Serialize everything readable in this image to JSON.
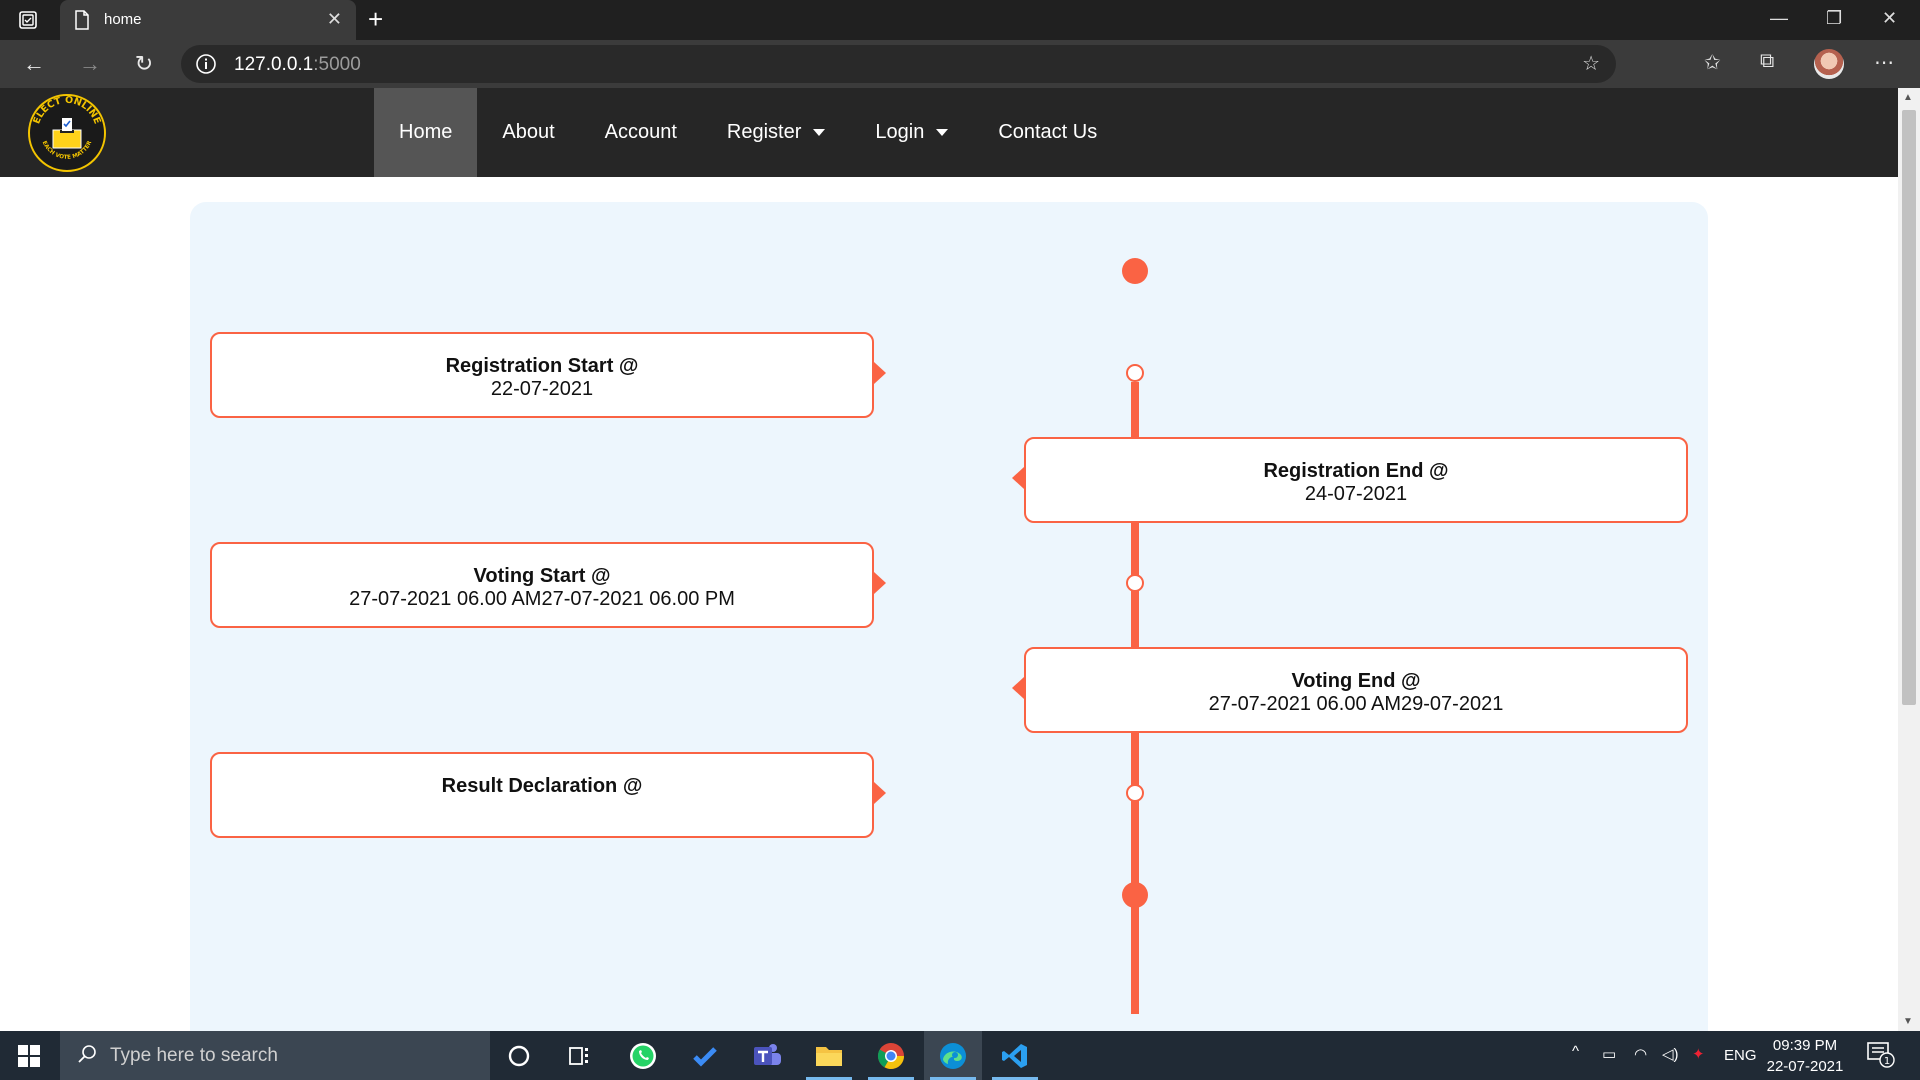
{
  "browser": {
    "tab_title": "home",
    "url_host": "127.0.0.1",
    "url_port": ":5000"
  },
  "site": {
    "logo_text_top": "ELECT ONLINE",
    "logo_text_bottom": "EACH VOTE MATTER",
    "nav": {
      "home": "Home",
      "about": "About",
      "account": "Account",
      "register": "Register",
      "login": "Login",
      "contact": "Contact Us"
    },
    "active_nav": "Home"
  },
  "timeline": [
    {
      "title": "Registration Start @",
      "date": "22-07-2021"
    },
    {
      "title": "Registration End @",
      "date": "24-07-2021"
    },
    {
      "title": "Voting Start @",
      "date": "27-07-2021 06.00 AM27-07-2021 06.00 PM"
    },
    {
      "title": "Voting End @",
      "date": "27-07-2021 06.00 AM29-07-2021"
    },
    {
      "title": "Result Declaration @",
      "date": ""
    }
  ],
  "colors": {
    "accent": "#fa6344",
    "navbar": "#262626",
    "nav_active": "#555555",
    "panel": "#edf6fd"
  },
  "taskbar": {
    "search_placeholder": "Type here to search",
    "apps": [
      "cortana-icon",
      "task-view-icon",
      "whatsapp-icon",
      "todo-icon",
      "teams-icon",
      "file-explorer-icon",
      "chrome-icon",
      "edge-icon",
      "vscode-icon"
    ],
    "language": "ENG",
    "time": "09:39 PM",
    "date": "22-07-2021",
    "notification_count": "1"
  }
}
